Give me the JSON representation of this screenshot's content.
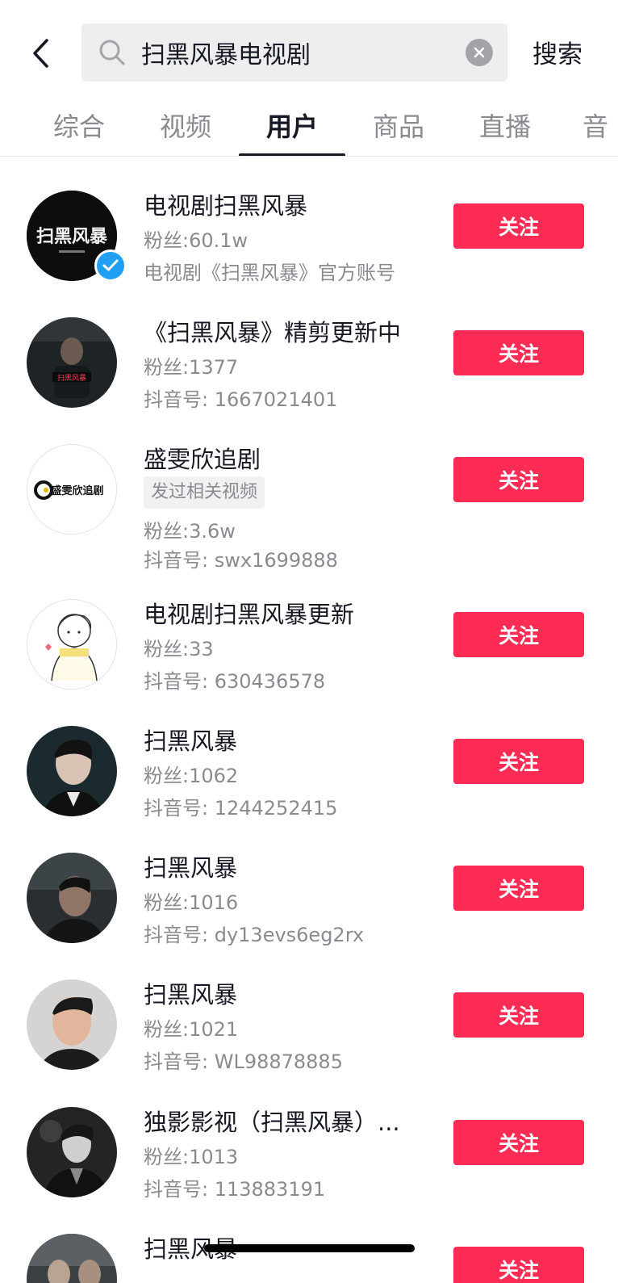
{
  "header": {
    "search_value": "扫黑风暴电视剧",
    "search_submit_label": "搜索"
  },
  "tabs": [
    {
      "label": "综合"
    },
    {
      "label": "视频"
    },
    {
      "label": "用户"
    },
    {
      "label": "商品"
    },
    {
      "label": "直播"
    },
    {
      "label": "音"
    }
  ],
  "active_tab": "用户",
  "users": [
    {
      "name": "电视剧扫黑风暴",
      "fans": "粉丝:60.1w",
      "desc": "电视剧《扫黑风暴》官方账号",
      "verified": true,
      "follow_label": "关注",
      "avatar_text": "扫黑风暴"
    },
    {
      "name": "《扫黑风暴》精剪更新中",
      "fans": "粉丝:1377",
      "id": "抖音号: 1667021401",
      "follow_label": "关注",
      "avatar_text": "扫黑风暴"
    },
    {
      "name": "盛雯欣追剧",
      "tag": "发过相关视频",
      "fans": "粉丝:3.6w",
      "id": "抖音号: swx1699888",
      "follow_label": "关注",
      "avatar_text": "盛雯欣追剧"
    },
    {
      "name": "电视剧扫黑风暴更新",
      "fans": "粉丝:33",
      "id": "抖音号: 630436578",
      "follow_label": "关注"
    },
    {
      "name": "扫黑风暴",
      "fans": "粉丝:1062",
      "id": "抖音号: 1244252415",
      "follow_label": "关注"
    },
    {
      "name": "扫黑风暴",
      "fans": "粉丝:1016",
      "id": "抖音号: dy13evs6eg2rx",
      "follow_label": "关注"
    },
    {
      "name": "扫黑风暴",
      "fans": "粉丝:1021",
      "id": "抖音号: WL98878885",
      "follow_label": "关注"
    },
    {
      "name": "独影影视（扫黑风暴）...",
      "fans": "粉丝:1013",
      "id": "抖音号: 113883191",
      "follow_label": "关注"
    },
    {
      "name": "扫黑风暴",
      "follow_label": "关注"
    }
  ],
  "colors": {
    "accent": "#fe2c55",
    "verified": "#20a0f4",
    "text_primary": "#161823",
    "text_secondary": "#8a8b91"
  }
}
